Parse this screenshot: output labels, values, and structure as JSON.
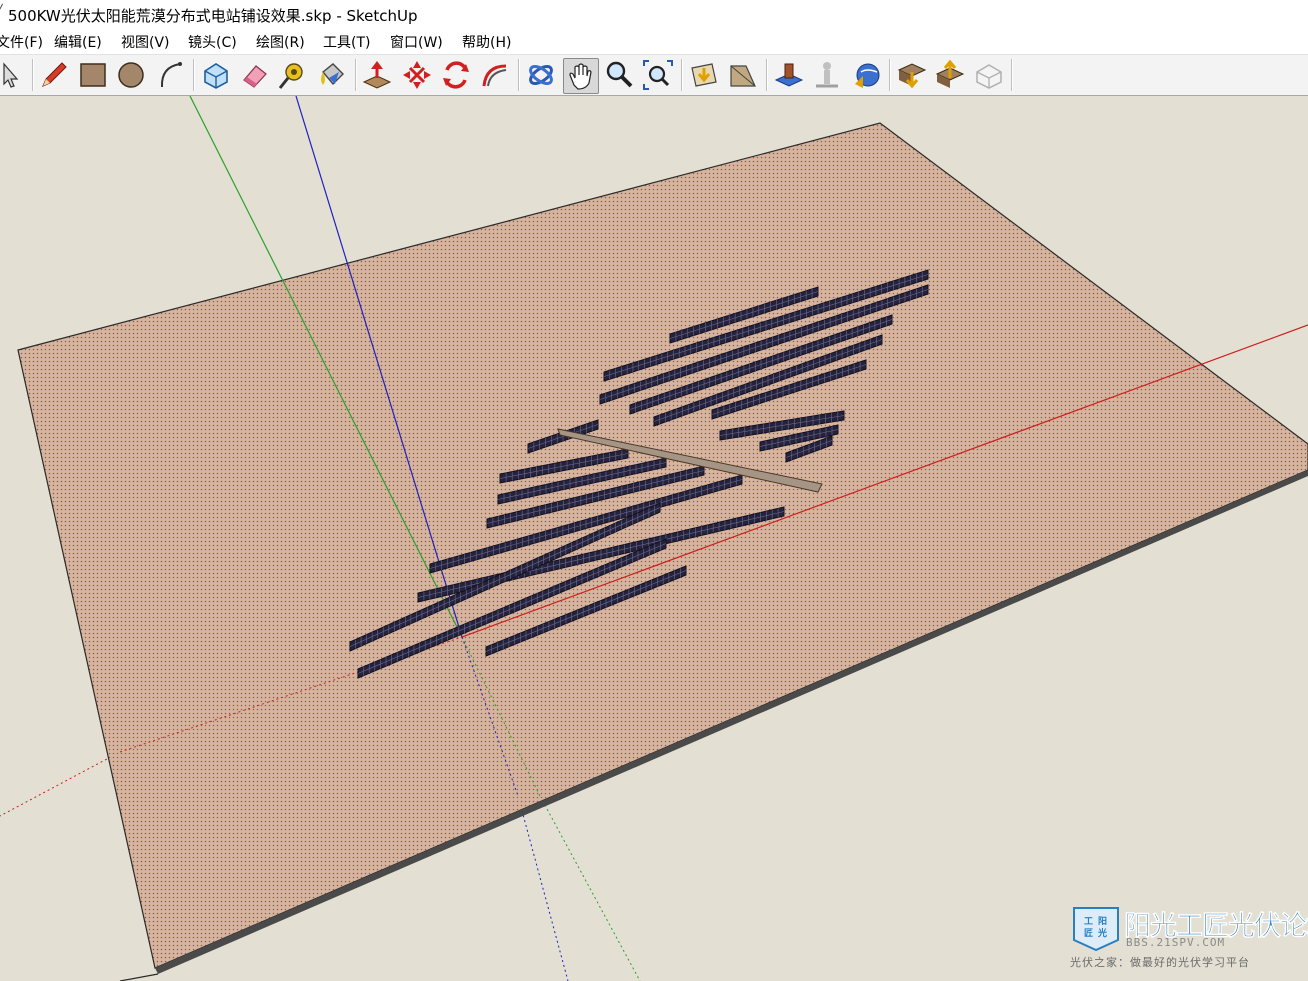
{
  "window": {
    "title": "500KW光伏太阳能荒漠分布式电站铺设效果.skp - SketchUp"
  },
  "menu": [
    {
      "label": "文件(F)"
    },
    {
      "label": "编辑(E)"
    },
    {
      "label": "视图(V)"
    },
    {
      "label": "镜头(C)"
    },
    {
      "label": "绘图(R)"
    },
    {
      "label": "工具(T)"
    },
    {
      "label": "窗口(W)"
    },
    {
      "label": "帮助(H)"
    }
  ],
  "toolbar": [
    {
      "icon": "select-arrow-icon"
    },
    {
      "icon": "pencil-line-icon"
    },
    {
      "icon": "rectangle-icon"
    },
    {
      "icon": "circle-icon"
    },
    {
      "icon": "arc-icon"
    },
    {
      "icon": "make-component-icon"
    },
    {
      "icon": "eraser-icon"
    },
    {
      "icon": "tape-measure-icon"
    },
    {
      "icon": "paint-bucket-icon"
    },
    {
      "icon": "push-pull-icon"
    },
    {
      "icon": "move-icon"
    },
    {
      "icon": "rotate-icon"
    },
    {
      "icon": "follow-me-icon"
    },
    {
      "icon": "orbit-icon"
    },
    {
      "icon": "pan-hand-icon"
    },
    {
      "icon": "zoom-icon"
    },
    {
      "icon": "zoom-extents-icon"
    },
    {
      "icon": "previous-view-icon"
    },
    {
      "icon": "next-view-icon"
    },
    {
      "icon": "add-location-icon"
    },
    {
      "icon": "toggle-terrain-icon"
    },
    {
      "icon": "google-earth-icon"
    },
    {
      "icon": "get-models-icon"
    },
    {
      "icon": "share-model-icon"
    },
    {
      "icon": "share-component-icon"
    }
  ],
  "colors": {
    "ground": "#d9b49a",
    "ground_dots": "#6f6470",
    "panel": "#25233a",
    "panel_grid": "#6d6a98",
    "beam": "#a69484",
    "axis_red": "#cc1f1f",
    "axis_green": "#2aa02a",
    "axis_blue": "#2020c0",
    "background": "#e3e0d3"
  },
  "watermark": {
    "name": "阳光工匠光伏论坛",
    "url": "BBS.21SPV.COM",
    "slogan": "光伏之家：做最好的光伏学习平台",
    "logo_text": "工阳匠光"
  }
}
